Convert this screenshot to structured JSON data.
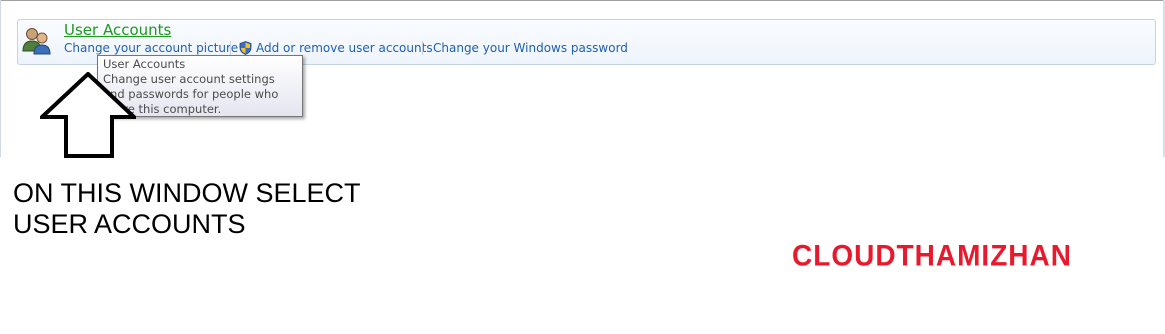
{
  "control_panel": {
    "category_title": "User Accounts",
    "links": [
      {
        "label": "Change your account picture"
      },
      {
        "label": "Add or remove user accounts"
      },
      {
        "label": "Change your Windows password"
      }
    ]
  },
  "tooltip": {
    "title": "User Accounts",
    "description": "Change user account settings and passwords for people who share this computer."
  },
  "annotation": {
    "line1": "ON THIS WINDOW SELECT",
    "line2": "USER ACCOUNTS"
  },
  "watermark": "CLOUDTHAMIZHAN",
  "colors": {
    "category_green": "#1e9a1e",
    "link_blue": "#1f5fb4",
    "watermark_red": "#e8192c"
  },
  "icons": [
    "user-accounts-icon",
    "uac-shield-icon",
    "up-arrow-icon"
  ]
}
